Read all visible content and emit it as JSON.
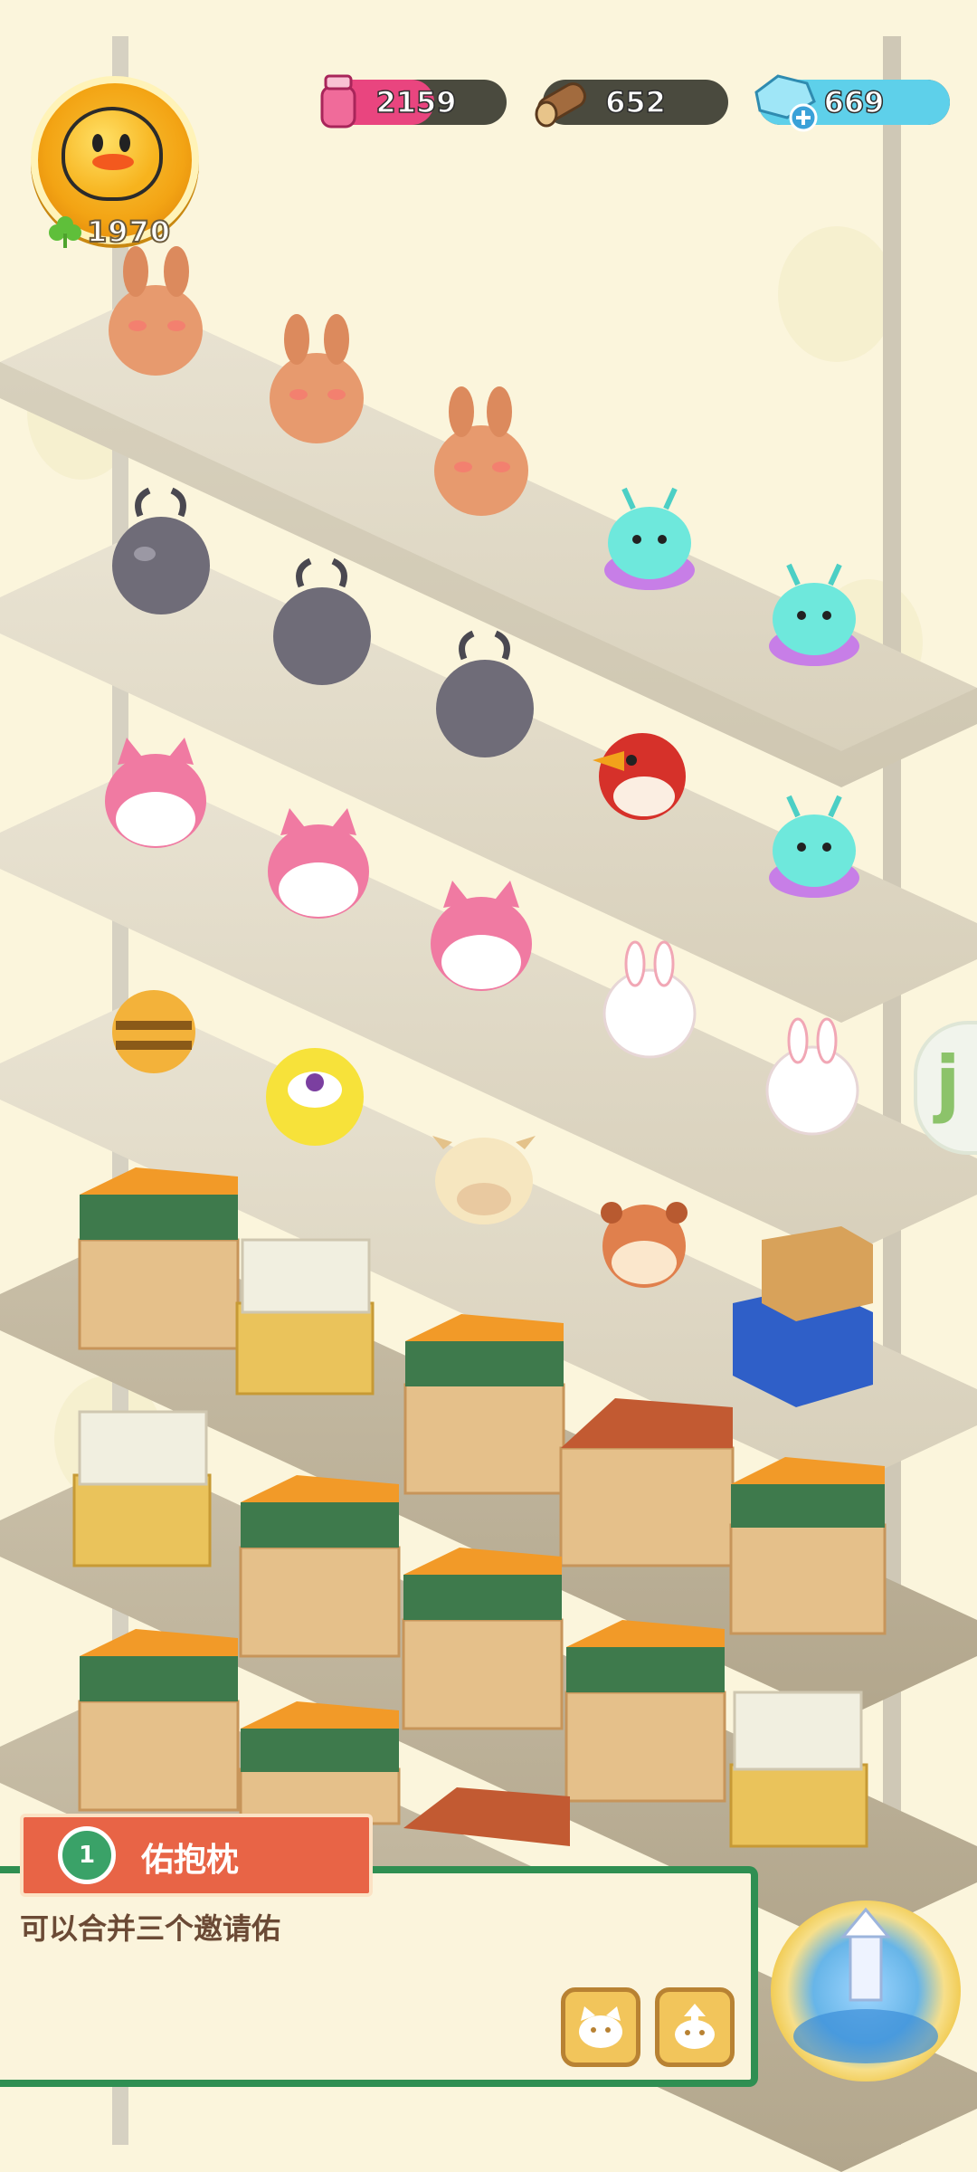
{
  "player": {
    "clover_count": "1970"
  },
  "resources": [
    {
      "name": "potion",
      "value": "2159",
      "icon": "potion-jar-icon",
      "color": "#e9457f"
    },
    {
      "name": "wood",
      "value": "652",
      "icon": "wood-log-icon",
      "color": "#7a5236"
    },
    {
      "name": "gems",
      "value": "669",
      "icon": "gem-plus-icon",
      "color": "#5ed0ea"
    }
  ],
  "task_panel": {
    "timer_badge": "1",
    "title": "佑抱枕",
    "description": "可以合并三个邀请佑",
    "buttons": [
      {
        "name": "cat-face-button",
        "icon": "cat-face-icon"
      },
      {
        "name": "upgrade-cat-button",
        "icon": "cat-up-arrow-icon"
      }
    ]
  },
  "shelf_rows": [
    {
      "items": [
        "brown-bunny",
        "brown-bunny",
        "brown-bunny",
        "cyan-jelly",
        "cyan-jelly"
      ]
    },
    {
      "items": [
        "gray-beetle",
        "gray-beetle",
        "gray-beetle",
        "red-bird",
        "cyan-jelly"
      ]
    },
    {
      "items": [
        "pink-fox",
        "pink-fox",
        "pink-fox",
        "white-bunny",
        "white-bunny"
      ]
    },
    {
      "items": [
        "bee",
        "yellow-cat",
        "cow",
        "hamster",
        "box-stack"
      ]
    }
  ],
  "colors": {
    "background": "#fbf5dc",
    "panel_border": "#2f8f52",
    "panel_tab": "#e86446"
  }
}
